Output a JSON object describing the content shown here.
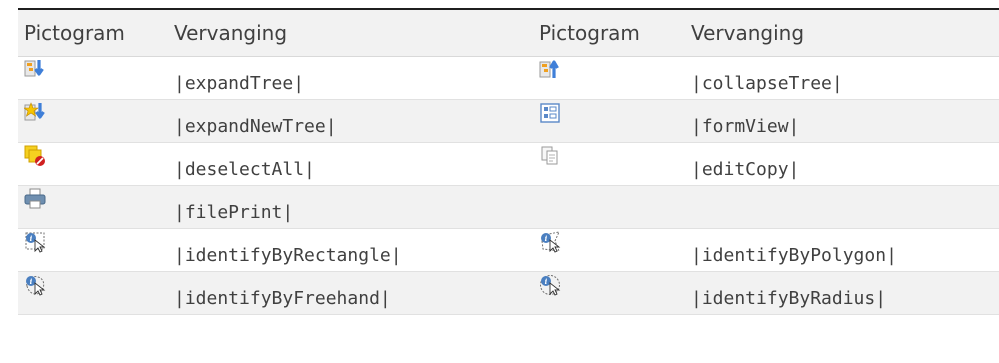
{
  "header": {
    "col1": "Pictogram",
    "col2": "Vervanging",
    "col3": "Pictogram",
    "col4": "Vervanging"
  },
  "rows": [
    {
      "left": {
        "icon": "expand-tree-icon",
        "code": "|expandTree|"
      },
      "right": {
        "icon": "collapse-tree-icon",
        "code": "|collapseTree|"
      }
    },
    {
      "left": {
        "icon": "expand-new-tree-icon",
        "code": "|expandNewTree|"
      },
      "right": {
        "icon": "form-view-icon",
        "code": "|formView|"
      }
    },
    {
      "left": {
        "icon": "deselect-all-icon",
        "code": "|deselectAll|"
      },
      "right": {
        "icon": "edit-copy-icon",
        "code": "|editCopy|"
      }
    },
    {
      "left": {
        "icon": "file-print-icon",
        "code": "|filePrint|"
      },
      "right": {
        "icon": "",
        "code": ""
      }
    },
    {
      "left": {
        "icon": "identify-by-rectangle-icon",
        "code": "|identifyByRectangle|"
      },
      "right": {
        "icon": "identify-by-polygon-icon",
        "code": "|identifyByPolygon|"
      }
    },
    {
      "left": {
        "icon": "identify-by-freehand-icon",
        "code": "|identifyByFreehand|"
      },
      "right": {
        "icon": "identify-by-radius-icon",
        "code": "|identifyByRadius|"
      }
    }
  ],
  "colors": {
    "header_bg": "#f2f2f2",
    "alt_row_bg": "#f2f2f2",
    "text": "#404040",
    "rule": "#1f1f1f",
    "arrow_blue": "#3f7fd8",
    "folder_orange": "#f0a020",
    "info_blue": "#4a7fc0",
    "stop_red": "#d02020"
  }
}
